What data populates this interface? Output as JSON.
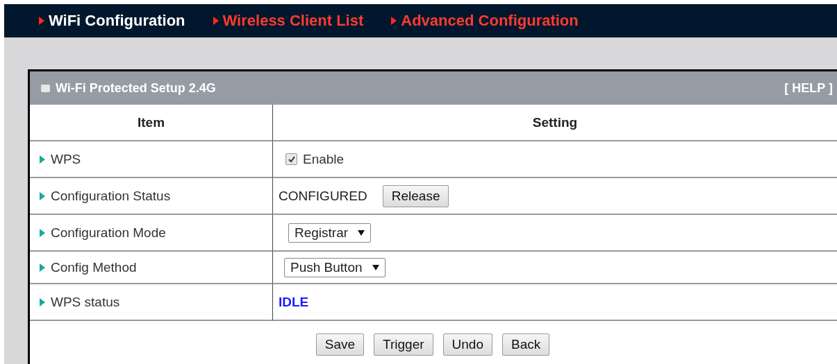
{
  "nav_tabs": [
    {
      "label": "WiFi Configuration",
      "selected": true
    },
    {
      "label": "Wireless Client List",
      "selected": false
    },
    {
      "label": "Advanced Configuration",
      "selected": false
    }
  ],
  "panel": {
    "title": "Wi-Fi Protected Setup 2.4G",
    "help": "[ HELP ]",
    "columns": [
      "Item",
      "Setting"
    ],
    "rows": [
      {
        "kind": "checkbox",
        "label": "WPS",
        "text": "Enable",
        "checked": true
      },
      {
        "kind": "status",
        "label": "Configuration Status",
        "text": "CONFIGURED",
        "button": "Release"
      },
      {
        "kind": "select",
        "label": "Configuration Mode",
        "value": "Registrar"
      },
      {
        "kind": "select",
        "label": "Config Method",
        "value": "Push Button"
      },
      {
        "kind": "highlight",
        "label": "WPS status",
        "text": "IDLE",
        "color": "#1a1aff"
      }
    ],
    "buttons": [
      "Save",
      "Trigger",
      "Undo",
      "Back"
    ]
  }
}
